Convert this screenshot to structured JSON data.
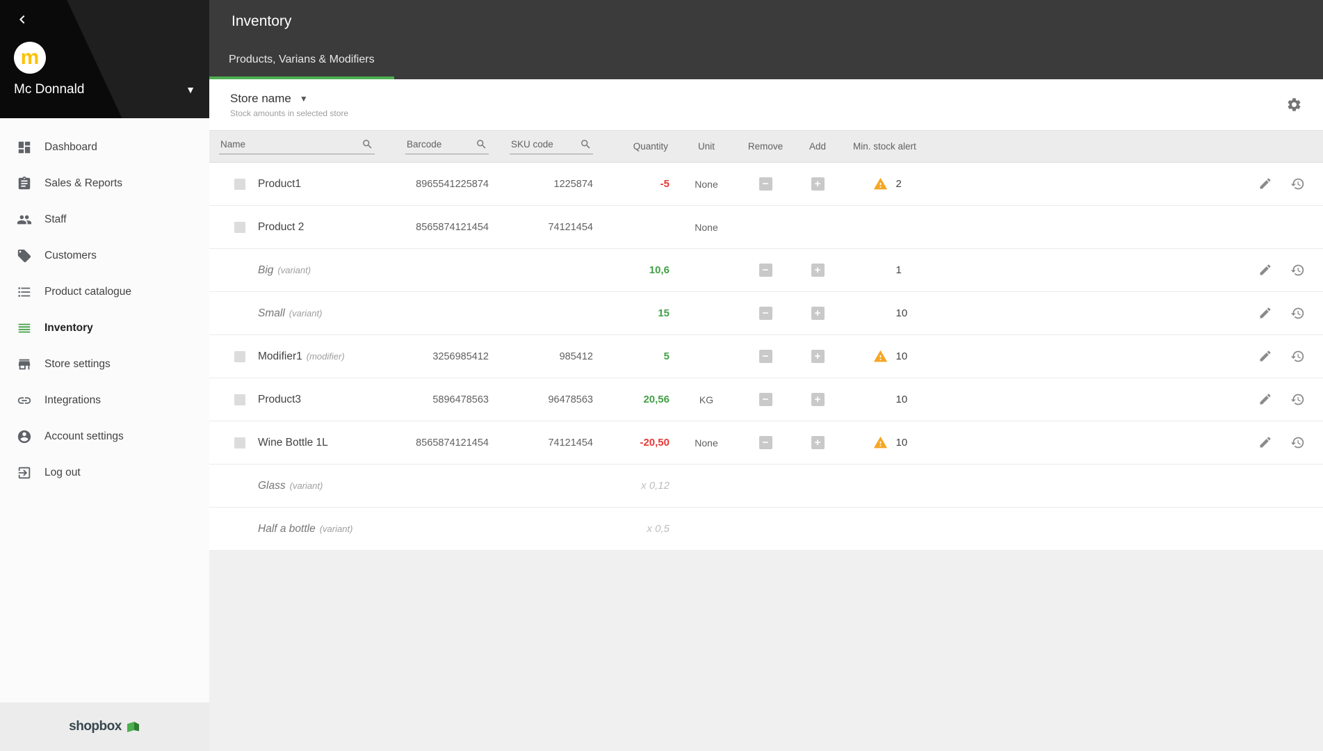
{
  "colors": {
    "accent_green": "#4caf50",
    "negative_red": "#e53935",
    "positive_green": "#43a047",
    "warning_orange": "#f5a623"
  },
  "sidebar": {
    "account": {
      "name": "Mc Donnald",
      "avatar_letter": "m"
    },
    "items": [
      {
        "label": "Dashboard",
        "icon": "dashboard-icon",
        "active": false
      },
      {
        "label": "Sales & Reports",
        "icon": "reports-icon",
        "active": false
      },
      {
        "label": "Staff",
        "icon": "staff-icon",
        "active": false
      },
      {
        "label": "Customers",
        "icon": "customers-icon",
        "active": false
      },
      {
        "label": "Product catalogue",
        "icon": "catalogue-icon",
        "active": false
      },
      {
        "label": "Inventory",
        "icon": "inventory-icon",
        "active": true
      },
      {
        "label": "Store settings",
        "icon": "store-icon",
        "active": false
      },
      {
        "label": "Integrations",
        "icon": "integrations-icon",
        "active": false
      },
      {
        "label": "Account settings",
        "icon": "account-icon",
        "active": false
      },
      {
        "label": "Log out",
        "icon": "logout-icon",
        "active": false
      }
    ],
    "logo_text": "shopbox"
  },
  "header": {
    "title": "Inventory"
  },
  "tabs": [
    {
      "label": "Products, Varians & Modifiers",
      "active": true
    }
  ],
  "toolbar": {
    "store_name": "Store name",
    "subtitle": "Stock amounts in selected store"
  },
  "table": {
    "headers": {
      "name": "Name",
      "barcode": "Barcode",
      "sku": "SKU code",
      "quantity": "Quantity",
      "unit": "Unit",
      "remove": "Remove",
      "add": "Add",
      "min_stock_alert": "Min. stock alert"
    },
    "rows": [
      {
        "name": "Product1",
        "suffix": "",
        "variant": false,
        "checkbox": true,
        "barcode": "8965541225874",
        "sku": "1225874",
        "qty": "-5",
        "qty_style": "neg",
        "unit": "None",
        "remove": true,
        "add": true,
        "alert": true,
        "min_stock": "2",
        "actions": true
      },
      {
        "name": "Product 2",
        "suffix": "",
        "variant": false,
        "checkbox": true,
        "barcode": "8565874121454",
        "sku": "74121454",
        "qty": "",
        "qty_style": "",
        "unit": "None",
        "remove": false,
        "add": false,
        "alert": false,
        "min_stock": "",
        "actions": false
      },
      {
        "name": "Big",
        "suffix": "(variant)",
        "variant": true,
        "checkbox": false,
        "barcode": "",
        "sku": "",
        "qty": "10,6",
        "qty_style": "pos",
        "unit": "",
        "remove": true,
        "add": true,
        "alert": false,
        "min_stock": "1",
        "actions": true
      },
      {
        "name": "Small",
        "suffix": "(variant)",
        "variant": true,
        "checkbox": false,
        "barcode": "",
        "sku": "",
        "qty": "15",
        "qty_style": "pos",
        "unit": "",
        "remove": true,
        "add": true,
        "alert": false,
        "min_stock": "10",
        "actions": true
      },
      {
        "name": "Modifier1",
        "suffix": "(modifier)",
        "variant": false,
        "checkbox": true,
        "barcode": "3256985412",
        "sku": "985412",
        "qty": "5",
        "qty_style": "pos",
        "unit": "",
        "remove": true,
        "add": true,
        "alert": true,
        "min_stock": "10",
        "actions": true
      },
      {
        "name": "Product3",
        "suffix": "",
        "variant": false,
        "checkbox": true,
        "barcode": "5896478563",
        "sku": "96478563",
        "qty": "20,56",
        "qty_style": "pos",
        "unit": "KG",
        "remove": true,
        "add": true,
        "alert": false,
        "min_stock": "10",
        "actions": true
      },
      {
        "name": "Wine Bottle 1L",
        "suffix": "",
        "variant": false,
        "checkbox": true,
        "barcode": "8565874121454",
        "sku": "74121454",
        "qty": "-20,50",
        "qty_style": "neg",
        "unit": "None",
        "remove": true,
        "add": true,
        "alert": true,
        "min_stock": "10",
        "actions": true
      },
      {
        "name": "Glass",
        "suffix": "(variant)",
        "variant": true,
        "checkbox": false,
        "barcode": "",
        "sku": "",
        "qty": "x 0,12",
        "qty_style": "muted",
        "unit": "",
        "remove": false,
        "add": false,
        "alert": false,
        "min_stock": "",
        "actions": false
      },
      {
        "name": "Half a bottle",
        "suffix": "(variant)",
        "variant": true,
        "checkbox": false,
        "barcode": "",
        "sku": "",
        "qty": "x 0,5",
        "qty_style": "muted",
        "unit": "",
        "remove": false,
        "add": false,
        "alert": false,
        "min_stock": "",
        "actions": false
      }
    ]
  }
}
